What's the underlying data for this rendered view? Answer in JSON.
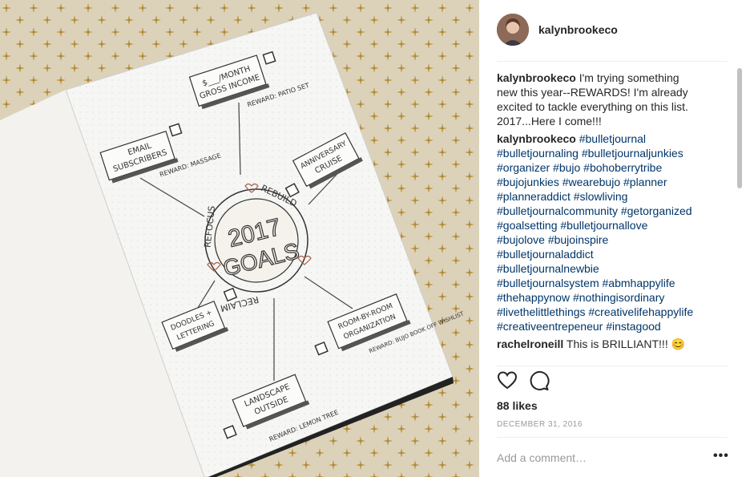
{
  "post": {
    "username": "kalynbrookeco",
    "likes": "88 likes",
    "date": "DECEMBER 31, 2016",
    "add_comment_placeholder": "Add a comment…",
    "more_glyph": "•••"
  },
  "comments": [
    {
      "user": "kalynbrookeco",
      "text": "I'm trying something new this year--REWARDS! I'm already excited to tackle everything on this list. 2017...Here I come!!!",
      "tags": ""
    },
    {
      "user": "kalynbrookeco",
      "text": "",
      "tags": "#bulletjournal #bulletjournaling #bulletjournaljunkies #organizer #bujo #bohoberrytribe #bujojunkies #wearebujo #planner #planneraddict #slowliving #bulletjournalcommunity #getorganized #goalsetting #bulletjournallove #bujolove #bujoinspire #bulletjournaladdict #bulletjournalnewbie #bulletjournalsystem #abmhappylife #thehappynow #nothingisordinary #livethelittlethings #creativelifehappylife #creativeentrepeneur #instagood"
    },
    {
      "user": "rachelroneill",
      "text": "This is BRILLIANT!!! 😊",
      "tags": ""
    }
  ],
  "journal": {
    "center_line1": "2017",
    "center_line2": "GOALS",
    "ring_words": [
      "REFOCUS",
      "REBUILD",
      "RECLAIM"
    ],
    "goals": [
      {
        "label1": "$___/MONTH",
        "label2": "GROSS INCOME",
        "reward": "REWARD: PATIO SET"
      },
      {
        "label1": "EMAIL",
        "label2": "SUBSCRIBERS",
        "reward": "REWARD: MASSAGE"
      },
      {
        "label1": "ANNIVERSARY",
        "label2": "CRUISE",
        "reward": ""
      },
      {
        "label1": "DOODLES +",
        "label2": "LETTERING",
        "reward": ""
      },
      {
        "label1": "ROOM-BY-ROOM",
        "label2": "ORGANIZATION",
        "reward": "REWARD: BUJO BOOK OFF WISHLIST"
      },
      {
        "label1": "LANDSCAPE",
        "label2": "OUTSIDE",
        "reward": "REWARD: LEMON TREE"
      }
    ]
  },
  "colors": {
    "tag_link": "#003569",
    "muted": "#999999",
    "like_heart": "#262626"
  },
  "icons": [
    "heart-icon",
    "comment-icon",
    "close-icon",
    "more-icon"
  ]
}
